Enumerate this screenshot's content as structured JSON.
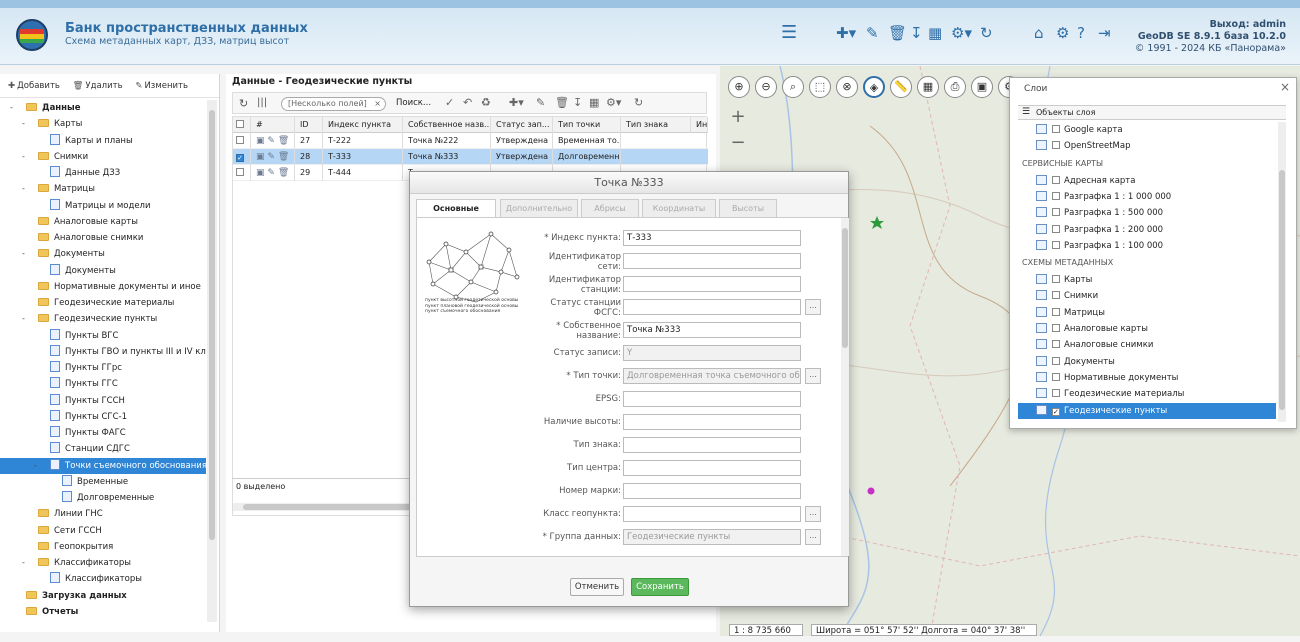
{
  "header": {
    "title": "Банк пространственных данных",
    "subtitle": "Схема метаданных карт, ДЗЗ, матриц высот",
    "exit": "Выход: admin",
    "version": "GeoDB SE 8.9.1 база 10.2.0",
    "copyright": "© 1991 - 2024 КБ «Панорама»"
  },
  "left": {
    "toolbar": {
      "add": "Добавить",
      "delete": "Удалить",
      "edit": "Изменить"
    },
    "tree": [
      {
        "label": "Данные",
        "level": 0,
        "tog": "-",
        "bold": true
      },
      {
        "label": "Карты",
        "level": 1,
        "tog": "-"
      },
      {
        "label": "Карты и планы",
        "level": 2
      },
      {
        "label": "Снимки",
        "level": 1,
        "tog": "-"
      },
      {
        "label": "Данные ДЗЗ",
        "level": 2
      },
      {
        "label": "Матрицы",
        "level": 1,
        "tog": "-"
      },
      {
        "label": "Матрицы и модели",
        "level": 2
      },
      {
        "label": "Аналоговые карты",
        "level": 1
      },
      {
        "label": "Аналоговые снимки",
        "level": 1
      },
      {
        "label": "Документы",
        "level": 1,
        "tog": "-"
      },
      {
        "label": "Документы",
        "level": 2
      },
      {
        "label": "Нормативные документы и иное",
        "level": 1
      },
      {
        "label": "Геодезические материалы",
        "level": 1
      },
      {
        "label": "Геодезические пункты",
        "level": 1,
        "tog": "-"
      },
      {
        "label": "Пункты ВГС",
        "level": 2
      },
      {
        "label": "Пункты ГВО и пункты III и IV классов",
        "level": 2
      },
      {
        "label": "Пункты ГГрс",
        "level": 2
      },
      {
        "label": "Пункты ГГС",
        "level": 2
      },
      {
        "label": "Пункты ГССН",
        "level": 2
      },
      {
        "label": "Пункты СГС-1",
        "level": 2
      },
      {
        "label": "Пункты ФАГС",
        "level": 2
      },
      {
        "label": "Станции СДГС",
        "level": 2
      },
      {
        "label": "Точки съемочного обоснования",
        "level": 2,
        "tog": "-",
        "selected": true
      },
      {
        "label": "Временные",
        "level": 3
      },
      {
        "label": "Долговременные",
        "level": 3
      },
      {
        "label": "Линии ГНС",
        "level": 1
      },
      {
        "label": "Сети ГССН",
        "level": 1
      },
      {
        "label": "Геопокрытия",
        "level": 1
      },
      {
        "label": "Классификаторы",
        "level": 1,
        "tog": "-"
      },
      {
        "label": "Классификаторы",
        "level": 2
      },
      {
        "label": "Загрузка данных",
        "level": 0,
        "bold": true
      },
      {
        "label": "Отчеты",
        "level": 0,
        "bold": true
      }
    ]
  },
  "grid": {
    "title": "Данные - Геодезические пункты",
    "search_placeholder": "[Несколько полей]",
    "search_button": "Поиск...",
    "columns": [
      "#",
      "ID",
      "Индекс пункта",
      "Собственное назв...",
      "Статус зап...",
      "Тип точки",
      "Тип знака",
      "Инд"
    ],
    "rows": [
      {
        "id": "27",
        "index": "Т-222",
        "name": "Точка №222",
        "status": "Утверждена",
        "type": "Временная то...",
        "checked": false
      },
      {
        "id": "28",
        "index": "Т-333",
        "name": "Точка №333",
        "status": "Утверждена",
        "type": "Долговременн...",
        "checked": true
      },
      {
        "id": "29",
        "index": "Т-444",
        "name": "Т",
        "status": "",
        "type": "",
        "checked": false
      }
    ],
    "footer": "0 выделено"
  },
  "dialog": {
    "title": "Точка №333",
    "tabs": [
      "Основные",
      "Дополнительно",
      "Абрисы",
      "Координаты",
      "Высоты"
    ],
    "legend": [
      "пункт высотной геодезической основы",
      "пункт плановой геодезической основы",
      "пункт съемочного обоснования"
    ],
    "fields": [
      {
        "label": "* Индекс пункта:",
        "value": "Т-333"
      },
      {
        "label": "Идентификатор сети:",
        "value": ""
      },
      {
        "label": "Идентификатор станции:",
        "value": ""
      },
      {
        "label": "Статус станции ФСГС:",
        "value": "",
        "dots": true
      },
      {
        "label": "* Собственное название:",
        "value": "Точка №333"
      },
      {
        "label": "Статус записи:",
        "value": "Y",
        "disabled": true
      },
      {
        "label": "* Тип точки:",
        "value": "Долговременная точка съемочного обосн",
        "dots": true,
        "disabled": true
      },
      {
        "label": "EPSG:",
        "value": ""
      },
      {
        "label": "Наличие высоты:",
        "value": ""
      },
      {
        "label": "Тип знака:",
        "value": ""
      },
      {
        "label": "Тип центра:",
        "value": ""
      },
      {
        "label": "Номер марки:",
        "value": ""
      },
      {
        "label": "Класс геопункта:",
        "value": "",
        "dots": true
      },
      {
        "label": "* Группа данных:",
        "value": "Геодезические пункты",
        "dots": true,
        "disabled": true
      }
    ],
    "cancel": "Отменить",
    "save": "Сохранить"
  },
  "layers": {
    "title": "Слои",
    "sublabel": "Объекты слоя",
    "items": [
      {
        "type": "item",
        "label": "Google карта",
        "checked": false
      },
      {
        "type": "item",
        "label": "OpenStreetMap",
        "checked": false
      },
      {
        "type": "group",
        "label": "СЕРВИСНЫЕ КАРТЫ"
      },
      {
        "type": "item",
        "label": "Адресная карта",
        "checked": false
      },
      {
        "type": "item",
        "label": "Разграфка 1 : 1 000 000",
        "checked": false
      },
      {
        "type": "item",
        "label": "Разграфка 1 : 500 000",
        "checked": false
      },
      {
        "type": "item",
        "label": "Разграфка 1 : 200 000",
        "checked": false
      },
      {
        "type": "item",
        "label": "Разграфка 1 : 100 000",
        "checked": false
      },
      {
        "type": "group",
        "label": "СХЕМЫ МЕТАДАННЫХ"
      },
      {
        "type": "item",
        "label": "Карты",
        "checked": false
      },
      {
        "type": "item",
        "label": "Снимки",
        "checked": false
      },
      {
        "type": "item",
        "label": "Матрицы",
        "checked": false
      },
      {
        "type": "item",
        "label": "Аналоговые карты",
        "checked": false
      },
      {
        "type": "item",
        "label": "Аналоговые снимки",
        "checked": false
      },
      {
        "type": "item",
        "label": "Документы",
        "checked": false
      },
      {
        "type": "item",
        "label": "Нормативные документы",
        "checked": false
      },
      {
        "type": "item",
        "label": "Геодезические материалы",
        "checked": false
      },
      {
        "type": "item",
        "label": "Геодезические пункты",
        "checked": true,
        "selected": true
      }
    ]
  },
  "map": {
    "scale": "1 : 8 735 660",
    "coords": "Широта = 051° 57' 52'' Долгота = 040° 37' 38''"
  }
}
